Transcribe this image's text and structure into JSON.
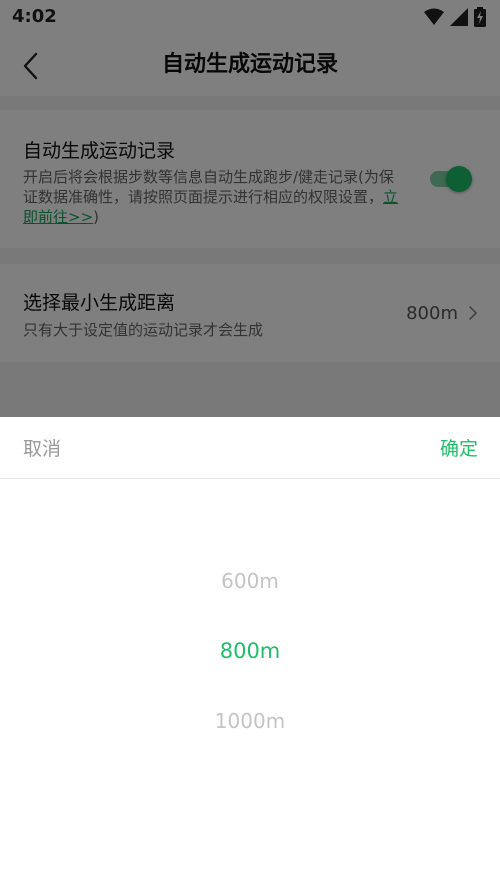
{
  "status_bar": {
    "time": "4:02",
    "icons": [
      "wifi-icon",
      "signal-icon",
      "battery-charging-icon"
    ]
  },
  "nav": {
    "title": "自动生成运动记录",
    "back_icon": "chevron-left-icon"
  },
  "auto_record": {
    "title": "自动生成运动记录",
    "description": "开启后将会根据步数等信息自动生成跑步/健走记录(为保证数据准确性，请按照页面提示进行相应的权限设置，",
    "link_text": "立即前往>>",
    "description_end": ")",
    "enabled": true
  },
  "min_distance": {
    "title": "选择最小生成距离",
    "description": "只有大于设定值的运动记录才会生成",
    "value": "800m"
  },
  "picker": {
    "cancel_label": "取消",
    "confirm_label": "确定",
    "options": [
      "600m",
      "800m",
      "1000m"
    ],
    "selected": "800m"
  },
  "colors": {
    "accent": "#1fbf69",
    "link": "#1aa35a",
    "overlay": "rgba(0,0,0,0.5)"
  }
}
